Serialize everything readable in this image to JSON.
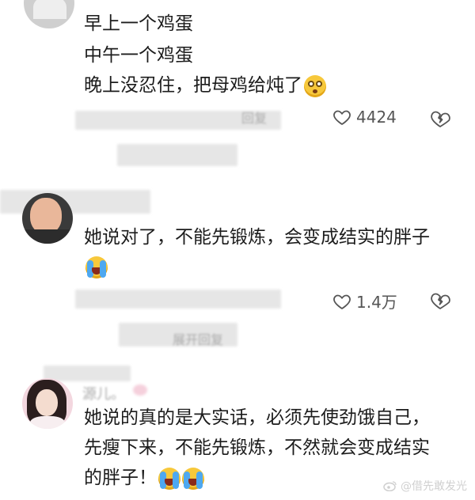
{
  "comments": [
    {
      "lines": [
        "早上一个鸡蛋",
        "中午一个鸡蛋",
        "晚上没忍住，把母鸡给炖了"
      ],
      "emoji": "dazed-face-emoji",
      "likes": "4424"
    },
    {
      "lines": [
        "她说对了，不能先锻炼，会变成结实的胖子"
      ],
      "emoji": "crying-laughing-emoji",
      "likes": "1.4万"
    },
    {
      "lines": [
        "她说的真的是大实话，必须先使劲饿自己，",
        "先瘦下来，不能先锻炼，不然就会变成结实",
        "的胖子！"
      ],
      "emoji": "crying-laughing-emoji"
    }
  ],
  "blurred": {
    "reply1": "回复",
    "expand": "展开回复",
    "username3": "源儿。"
  },
  "watermark": "@借先敢发光",
  "colors": {
    "text": "#1c1c1c",
    "count": "#555555",
    "watermark": "#d0d0d0"
  }
}
